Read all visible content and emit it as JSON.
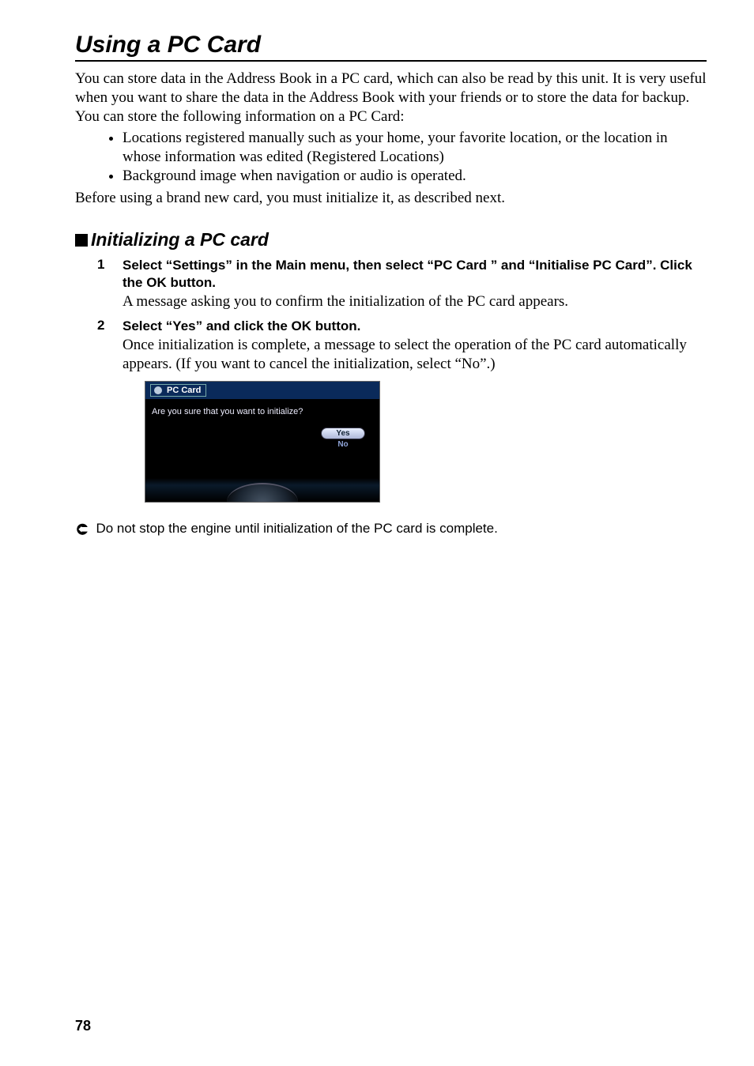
{
  "page": {
    "title": "Using a PC Card",
    "intro_p1": "You can store data in the Address Book in a PC card, which can also be read by this unit. It is very useful when you want to share the data in the Address Book with your friends or to store the data for backup.",
    "intro_p2": "You can store the following information on a PC Card:",
    "bullets": [
      "Locations registered manually such as your home, your favorite location, or the location in whose information was edited (Registered Locations)",
      "Background image when navigation or audio is operated."
    ],
    "intro_p3": "Before using a brand new card, you must initialize it, as described next.",
    "page_number": "78"
  },
  "section": {
    "title": "Initializing a PC card"
  },
  "steps": [
    {
      "num": "1",
      "title": "Select “Settings” in the Main menu, then select “PC Card ” and “Initialise PC Card”. Click the OK button.",
      "desc": "A message asking you to confirm the initialization of the PC card appears."
    },
    {
      "num": "2",
      "title": "Select “Yes” and click the OK button.",
      "desc": "Once initialization is complete, a message to select the operation of the PC card automatically appears. (If you want to cancel the initialization, select “No”.)"
    }
  ],
  "figure": {
    "titlebar": "PC Card",
    "prompt": "Are you sure that you want to initialize?",
    "yes": "Yes",
    "no": "No"
  },
  "note": {
    "text": "Do not stop the engine until initialization of the PC card is complete."
  }
}
